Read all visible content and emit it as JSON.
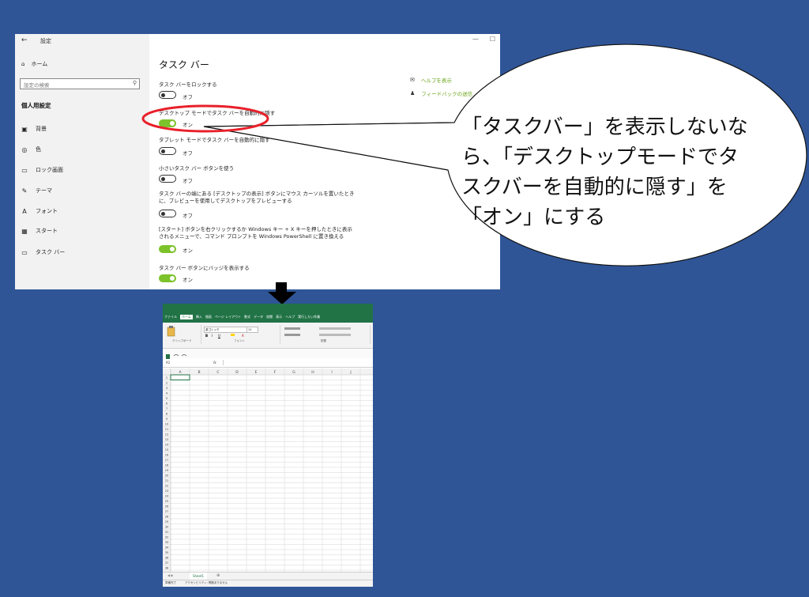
{
  "settings_window": {
    "back_glyph": "←",
    "title": "設定",
    "win_controls": [
      "—",
      "☐"
    ],
    "sidebar": {
      "home": "ホーム",
      "search_placeholder": "設定の検索",
      "section_title": "個人用設定",
      "items": [
        {
          "icon": "image-icon",
          "glyph": "▣",
          "label": "背景"
        },
        {
          "icon": "palette-icon",
          "glyph": "◎",
          "label": "色"
        },
        {
          "icon": "lock-screen-icon",
          "glyph": "▭",
          "label": "ロック画面"
        },
        {
          "icon": "theme-icon",
          "glyph": "✎",
          "label": "テーマ"
        },
        {
          "icon": "font-icon",
          "glyph": "A",
          "label": "フォント"
        },
        {
          "icon": "start-icon",
          "glyph": "▦",
          "label": "スタート"
        },
        {
          "icon": "taskbar-icon",
          "glyph": "▭",
          "label": "タスク バー"
        }
      ]
    },
    "page_title": "タスク バー",
    "options": [
      {
        "label": "タスク バーをロックする",
        "state": "オフ",
        "on": false
      },
      {
        "label": "デスクトップ モードでタスク バーを自動的に隠す",
        "state": "オン",
        "on": true
      },
      {
        "label": "タブレット モードでタスク バーを自動的に隠す",
        "state": "オフ",
        "on": false
      },
      {
        "label": "小さいタスク バー ボタンを使う",
        "state": "オフ",
        "on": false
      },
      {
        "label": "タスク バーの端にある [デスクトップの表示] ボタンにマウス カーソルを置いたときに、プレビューを使用してデスクトップをプレビューする",
        "state": "オフ",
        "on": false
      },
      {
        "label": "[スタート] ボタンを右クリックするか Windows キー + X キーを押したときに表示されるメニューで、コマンド プロンプトを Windows PowerShell に置き換える",
        "state": "オン",
        "on": true
      },
      {
        "label": "タスク バー ボタンにバッジを表示する",
        "state": "オン",
        "on": true
      }
    ],
    "links": [
      {
        "icon": "help-icon",
        "label": "ヘルプを表示"
      },
      {
        "icon": "feedback-icon",
        "label": "フィードバックの送信"
      }
    ]
  },
  "callout": {
    "lines": [
      "「タスクバー」を表示しないな",
      "ら、「デスクトップモードでタ",
      "スクバーを自動的に隠す」を",
      "「オン」にする"
    ]
  },
  "excel": {
    "tabs": [
      "ファイル",
      "ホーム",
      "挿入",
      "描画",
      "ページ レイアウト",
      "数式",
      "データ",
      "校閲",
      "表示",
      "ヘルプ",
      "実行したい作業"
    ],
    "active_tab": "ホーム",
    "ribbon_groups": [
      "クリップボード",
      "フォント",
      "配置"
    ],
    "font_name": "游ゴシック",
    "font_size": "11",
    "name_box": "A1",
    "fx": "fx",
    "columns": [
      "A",
      "B",
      "C",
      "D",
      "E",
      "F",
      "G",
      "H",
      "I",
      "J"
    ],
    "row_count": 38,
    "sheet_name": "Sheet1",
    "status_left": "準備完了",
    "status_access": "アクセシビリティ: 問題ありません"
  },
  "colors": {
    "background": "#2f5597",
    "toggle_on": "#7cc22b",
    "link": "#6ba318",
    "highlight": "#e8202a",
    "excel_green": "#217346"
  }
}
